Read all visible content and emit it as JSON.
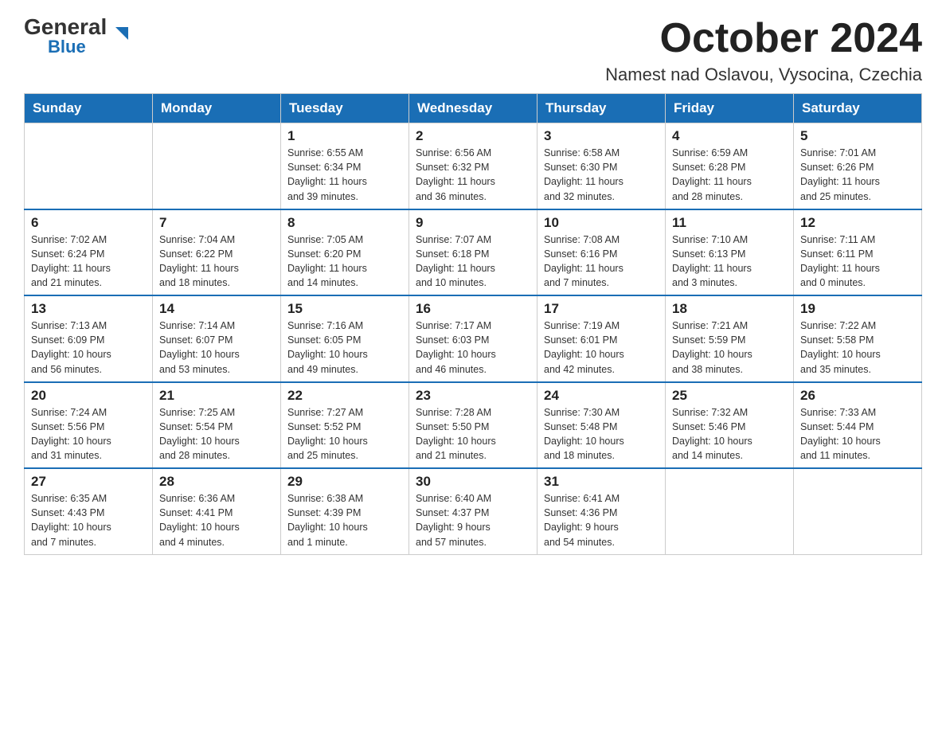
{
  "header": {
    "logo_general": "General",
    "logo_blue": "Blue",
    "month_title": "October 2024",
    "location": "Namest nad Oslavou, Vysocina, Czechia"
  },
  "days_of_week": [
    "Sunday",
    "Monday",
    "Tuesday",
    "Wednesday",
    "Thursday",
    "Friday",
    "Saturday"
  ],
  "weeks": [
    [
      {
        "day": "",
        "info": ""
      },
      {
        "day": "",
        "info": ""
      },
      {
        "day": "1",
        "info": "Sunrise: 6:55 AM\nSunset: 6:34 PM\nDaylight: 11 hours\nand 39 minutes."
      },
      {
        "day": "2",
        "info": "Sunrise: 6:56 AM\nSunset: 6:32 PM\nDaylight: 11 hours\nand 36 minutes."
      },
      {
        "day": "3",
        "info": "Sunrise: 6:58 AM\nSunset: 6:30 PM\nDaylight: 11 hours\nand 32 minutes."
      },
      {
        "day": "4",
        "info": "Sunrise: 6:59 AM\nSunset: 6:28 PM\nDaylight: 11 hours\nand 28 minutes."
      },
      {
        "day": "5",
        "info": "Sunrise: 7:01 AM\nSunset: 6:26 PM\nDaylight: 11 hours\nand 25 minutes."
      }
    ],
    [
      {
        "day": "6",
        "info": "Sunrise: 7:02 AM\nSunset: 6:24 PM\nDaylight: 11 hours\nand 21 minutes."
      },
      {
        "day": "7",
        "info": "Sunrise: 7:04 AM\nSunset: 6:22 PM\nDaylight: 11 hours\nand 18 minutes."
      },
      {
        "day": "8",
        "info": "Sunrise: 7:05 AM\nSunset: 6:20 PM\nDaylight: 11 hours\nand 14 minutes."
      },
      {
        "day": "9",
        "info": "Sunrise: 7:07 AM\nSunset: 6:18 PM\nDaylight: 11 hours\nand 10 minutes."
      },
      {
        "day": "10",
        "info": "Sunrise: 7:08 AM\nSunset: 6:16 PM\nDaylight: 11 hours\nand 7 minutes."
      },
      {
        "day": "11",
        "info": "Sunrise: 7:10 AM\nSunset: 6:13 PM\nDaylight: 11 hours\nand 3 minutes."
      },
      {
        "day": "12",
        "info": "Sunrise: 7:11 AM\nSunset: 6:11 PM\nDaylight: 11 hours\nand 0 minutes."
      }
    ],
    [
      {
        "day": "13",
        "info": "Sunrise: 7:13 AM\nSunset: 6:09 PM\nDaylight: 10 hours\nand 56 minutes."
      },
      {
        "day": "14",
        "info": "Sunrise: 7:14 AM\nSunset: 6:07 PM\nDaylight: 10 hours\nand 53 minutes."
      },
      {
        "day": "15",
        "info": "Sunrise: 7:16 AM\nSunset: 6:05 PM\nDaylight: 10 hours\nand 49 minutes."
      },
      {
        "day": "16",
        "info": "Sunrise: 7:17 AM\nSunset: 6:03 PM\nDaylight: 10 hours\nand 46 minutes."
      },
      {
        "day": "17",
        "info": "Sunrise: 7:19 AM\nSunset: 6:01 PM\nDaylight: 10 hours\nand 42 minutes."
      },
      {
        "day": "18",
        "info": "Sunrise: 7:21 AM\nSunset: 5:59 PM\nDaylight: 10 hours\nand 38 minutes."
      },
      {
        "day": "19",
        "info": "Sunrise: 7:22 AM\nSunset: 5:58 PM\nDaylight: 10 hours\nand 35 minutes."
      }
    ],
    [
      {
        "day": "20",
        "info": "Sunrise: 7:24 AM\nSunset: 5:56 PM\nDaylight: 10 hours\nand 31 minutes."
      },
      {
        "day": "21",
        "info": "Sunrise: 7:25 AM\nSunset: 5:54 PM\nDaylight: 10 hours\nand 28 minutes."
      },
      {
        "day": "22",
        "info": "Sunrise: 7:27 AM\nSunset: 5:52 PM\nDaylight: 10 hours\nand 25 minutes."
      },
      {
        "day": "23",
        "info": "Sunrise: 7:28 AM\nSunset: 5:50 PM\nDaylight: 10 hours\nand 21 minutes."
      },
      {
        "day": "24",
        "info": "Sunrise: 7:30 AM\nSunset: 5:48 PM\nDaylight: 10 hours\nand 18 minutes."
      },
      {
        "day": "25",
        "info": "Sunrise: 7:32 AM\nSunset: 5:46 PM\nDaylight: 10 hours\nand 14 minutes."
      },
      {
        "day": "26",
        "info": "Sunrise: 7:33 AM\nSunset: 5:44 PM\nDaylight: 10 hours\nand 11 minutes."
      }
    ],
    [
      {
        "day": "27",
        "info": "Sunrise: 6:35 AM\nSunset: 4:43 PM\nDaylight: 10 hours\nand 7 minutes."
      },
      {
        "day": "28",
        "info": "Sunrise: 6:36 AM\nSunset: 4:41 PM\nDaylight: 10 hours\nand 4 minutes."
      },
      {
        "day": "29",
        "info": "Sunrise: 6:38 AM\nSunset: 4:39 PM\nDaylight: 10 hours\nand 1 minute."
      },
      {
        "day": "30",
        "info": "Sunrise: 6:40 AM\nSunset: 4:37 PM\nDaylight: 9 hours\nand 57 minutes."
      },
      {
        "day": "31",
        "info": "Sunrise: 6:41 AM\nSunset: 4:36 PM\nDaylight: 9 hours\nand 54 minutes."
      },
      {
        "day": "",
        "info": ""
      },
      {
        "day": "",
        "info": ""
      }
    ]
  ]
}
